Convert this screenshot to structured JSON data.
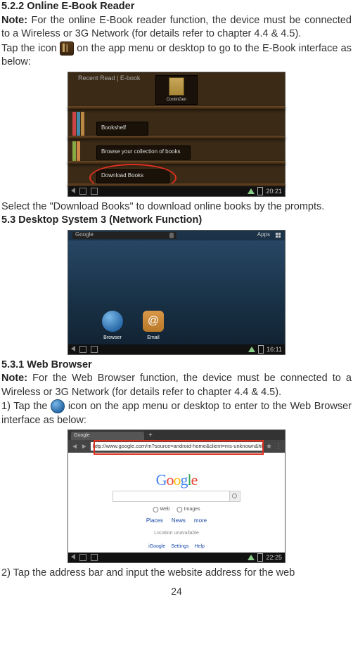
{
  "section_522_title": "5.2.2 Online E-Book Reader",
  "note_label": "Note:",
  "note_522_text": " For the online E-Book reader function, the device must be connected to a Wireless or 3G Network (for details refer to chapter 4.4 & 4.5).",
  "tap_icon_pre": "Tap the icon ",
  "tap_icon_post": " on the app menu or desktop to go to the E-Book interface as below:",
  "shot1": {
    "topbar": "Recent Read | E-book",
    "center_label": "ContinGen",
    "btn_shelf": "Bookshelf",
    "btn_browse": "Browse your collection of books",
    "btn_download": "Download Books",
    "time": "20:21"
  },
  "after_shot1": "Select the \"Download Books\" to download online books by the prompts.",
  "section_53_title": "5.3 Desktop System 3 (Network Function)",
  "shot2": {
    "search_label": "Google",
    "apps_label": "Apps",
    "browser_label": "Browser",
    "email_label": "Email",
    "email_icon": "@",
    "time": "16:11"
  },
  "section_531_title": "5.3.1 Web Browser",
  "note_531_text": " For the Web Browser function, the device must be connected to a Wireless or 3G Network (for details refer to chapter 4.4 & 4.5).",
  "tap_browser_pre": "1) Tap the ",
  "tap_browser_post": " icon on the app menu or desktop to enter to the Web Browser interface as below:",
  "shot3": {
    "tab_title": "Google",
    "url": "http://www.google.com/m?source=android-home&client=ms-unknown&hl=en",
    "radio_web": "Web",
    "radio_images": "Images",
    "nav_places": "Places",
    "nav_news": "News",
    "nav_more": "more",
    "location_hint": "Location unavailable",
    "foot_igoogle": "iGoogle",
    "foot_settings": "Settings",
    "foot_help": "Help",
    "time": "22:25"
  },
  "after_shot3": "2) Tap the address bar and input the website address for the web",
  "page_num": "24"
}
